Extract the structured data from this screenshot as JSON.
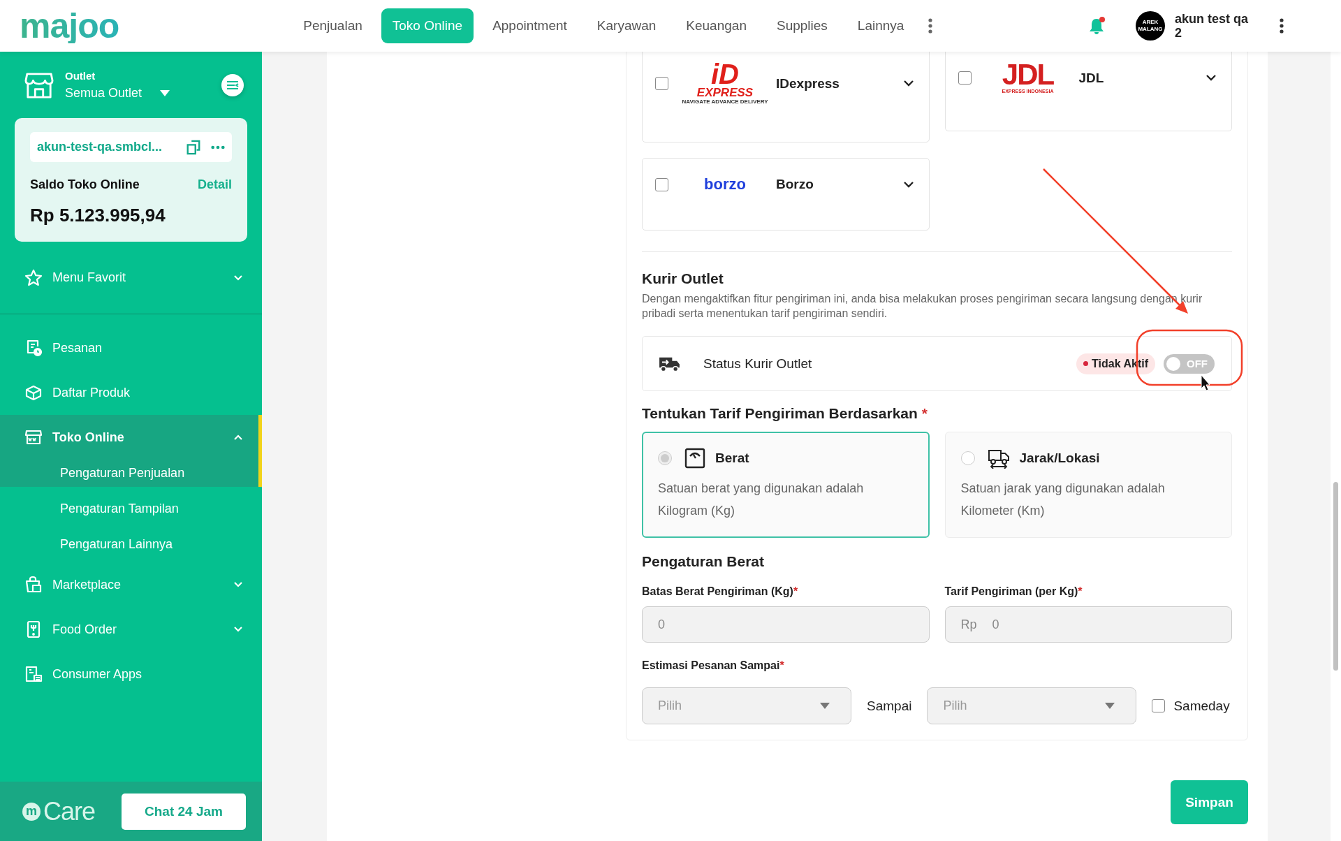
{
  "header": {
    "logo": "majoo",
    "nav": [
      {
        "label": "Penjualan",
        "selected": false
      },
      {
        "label": "Toko Online",
        "selected": true
      },
      {
        "label": "Appointment",
        "selected": false
      },
      {
        "label": "Karyawan",
        "selected": false
      },
      {
        "label": "Keuangan",
        "selected": false
      },
      {
        "label": "Supplies",
        "selected": false
      },
      {
        "label": "Lainnya",
        "selected": false
      }
    ],
    "notification": {
      "unread": true
    },
    "user": {
      "avatar_text": "AREK MALANG",
      "name": "akun test qa 2"
    }
  },
  "sidebar": {
    "outlet": {
      "label": "Outlet",
      "value": "Semua Outlet"
    },
    "store_card": {
      "url": "akun-test-qa.smbcl...",
      "balance_label": "Saldo Toko Online",
      "detail_link": "Detail",
      "balance": "Rp 5.123.995,94"
    },
    "favorites": {
      "label": "Menu Favorit",
      "expanded": false
    },
    "menu": [
      {
        "label": "Pesanan",
        "kind": "receipt",
        "selected": false
      },
      {
        "label": "Daftar Produk",
        "kind": "box",
        "selected": false
      },
      {
        "label": "Toko Online",
        "kind": "shop",
        "selected": true,
        "expanded": true,
        "children": [
          {
            "label": "Pengaturan Penjualan",
            "selected": true
          },
          {
            "label": "Pengaturan Tampilan",
            "selected": false
          },
          {
            "label": "Pengaturan Lainnya",
            "selected": false
          }
        ]
      },
      {
        "label": "Marketplace",
        "kind": "bag",
        "selected": false,
        "expanded": false
      },
      {
        "label": "Food Order",
        "kind": "phone",
        "selected": false,
        "expanded": false
      },
      {
        "label": "Consumer Apps",
        "kind": "apps",
        "selected": false
      }
    ],
    "care": {
      "mark": "m",
      "label": "Care",
      "button": "Chat 24 Jam"
    }
  },
  "couriers": [
    {
      "name": "IDexpress",
      "checked": false,
      "logo": {
        "kind": "idexpress",
        "lines": [
          "iD",
          "EXPRESS",
          "NAVIGATE ADVANCE DELIVERY"
        ]
      }
    },
    {
      "name": "JDL",
      "checked": false,
      "logo": {
        "kind": "jdl",
        "lines": [
          "JDL",
          "EXPRESS INDONESIA"
        ]
      }
    },
    {
      "name": "Borzo",
      "checked": false,
      "logo": {
        "kind": "borzo",
        "lines": [
          "borzo"
        ]
      }
    }
  ],
  "kurir_outlet": {
    "title": "Kurir Outlet",
    "description": "Dengan mengaktifkan fitur pengiriman ini, anda bisa melakukan proses pengiriman secara langsung dengan kurir pribadi serta menentukan tarif pengiriman sendiri.",
    "status": {
      "label": "Status Kurir Outlet",
      "badge": "Tidak Aktif",
      "on": false,
      "toggle_label": "OFF"
    }
  },
  "tariff": {
    "title": "Tentukan Tarif Pengiriman Berdasarkan",
    "required_mark": "*",
    "options": [
      {
        "title": "Berat",
        "kind": "scale",
        "description": "Satuan berat yang digunakan adalah Kilogram (Kg)",
        "selected": true
      },
      {
        "title": "Jarak/Lokasi",
        "kind": "truck",
        "description": "Satuan jarak yang digunakan adalah Kilometer (Km)",
        "selected": false
      }
    ]
  },
  "weight_settings": {
    "title": "Pengaturan Berat",
    "fields": [
      {
        "label": "Batas Berat Pengiriman (Kg)",
        "required_mark": "*",
        "value": "0"
      },
      {
        "label": "Tarif Pengiriman (per Kg)",
        "required_mark": "*",
        "prefix": "Rp",
        "value": "0"
      }
    ],
    "estimate": {
      "label": "Estimasi Pesanan Sampai",
      "required_mark": "*",
      "from": {
        "placeholder": "Pilih"
      },
      "separator": "Sampai",
      "to": {
        "placeholder": "Pilih"
      },
      "sameday": {
        "label": "Sameday",
        "checked": false
      }
    }
  },
  "save_button": "Simpan"
}
